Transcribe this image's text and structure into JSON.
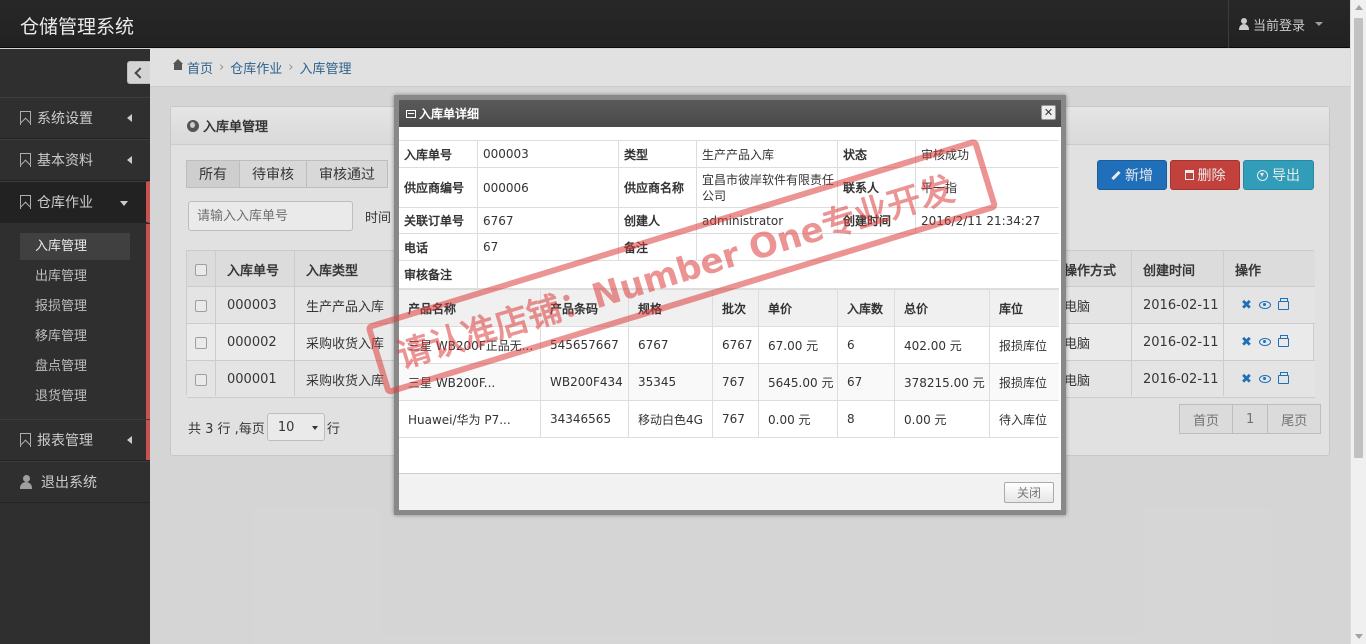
{
  "header": {
    "brand": "仓储管理系统",
    "user_label": "当前登录"
  },
  "sidebar": {
    "groups": [
      {
        "label": "系统设置"
      },
      {
        "label": "基本资料"
      },
      {
        "label": "仓库作业"
      },
      {
        "label": "报表管理"
      },
      {
        "label": "退出系统"
      }
    ],
    "sub_items": [
      "入库管理",
      "出库管理",
      "报损管理",
      "移库管理",
      "盘点管理",
      "退货管理"
    ]
  },
  "breadcrumb": [
    "首页",
    "仓库作业",
    "入库管理"
  ],
  "panel": {
    "title": "入库单管理",
    "tabs": [
      "所有",
      "待审核",
      "审核通过"
    ],
    "buttons": {
      "add": "新增",
      "delete": "删除",
      "export": "导出"
    },
    "search_placeholder": "请输入入库单号",
    "time_label": "时间",
    "columns": {
      "no": "入库单号",
      "type": "入库类型",
      "method": "操作方式",
      "created": "创建时间",
      "actions": "操作"
    },
    "rows": [
      {
        "no": "000003",
        "type": "生产产品入库",
        "method": "电脑",
        "created": "2016-02-11"
      },
      {
        "no": "000002",
        "type": "采购收货入库",
        "method": "电脑",
        "created": "2016-02-11"
      },
      {
        "no": "000001",
        "type": "采购收货入库",
        "method": "电脑",
        "created": "2016-02-11"
      }
    ],
    "footer": {
      "total": "共 3 行 ,每页",
      "page_size": "10",
      "unit": "行"
    },
    "pager": [
      "首页",
      "1",
      "尾页"
    ]
  },
  "modal": {
    "title": "入库单详细",
    "info": {
      "no_label": "入库单号",
      "no": "000003",
      "type_label": "类型",
      "type": "生产产品入库",
      "status_label": "状态",
      "status": "审核成功",
      "supplier_no_label": "供应商编号",
      "supplier_no": "000006",
      "supplier_name_label": "供应商名称",
      "supplier_name": "宜昌市彼岸软件有限责任公司",
      "contact_label": "联系人",
      "contact": "平一指",
      "order_label": "关联订单号",
      "order": "6767",
      "creator_label": "创建人",
      "creator": "administrator",
      "created_label": "创建时间",
      "created": "2016/2/11 21:34:27",
      "phone_label": "电话",
      "phone": "67",
      "remark_label": "备注",
      "remark": "",
      "audit_remark_label": "审核备注",
      "audit_remark": ""
    },
    "detail_columns": [
      "产品名称",
      "产品条码",
      "规格",
      "批次",
      "单价",
      "入库数",
      "总价",
      "库位"
    ],
    "detail_rows": [
      [
        "三星 WB200F正品无...",
        "545657667",
        "6767",
        "6767",
        "67.00 元",
        "6",
        "402.00 元",
        "报损库位"
      ],
      [
        "三星 WB200F...",
        "WB200F434",
        "35345",
        "767",
        "5645.00 元",
        "67",
        "378215.00 元",
        "报损库位"
      ],
      [
        "Huawei/华为 P7...",
        "34346565",
        "移动白色4G",
        "767",
        "0.00 元",
        "8",
        "0.00 元",
        "待入库位"
      ]
    ],
    "close_label": "关闭"
  },
  "watermark": "请认准店铺：Number One专业开发",
  "colors": {
    "accent": "#1a74c9",
    "danger": "#d23f3a",
    "info": "#2ea8c8",
    "sidebar_active_bar": "#d9534f",
    "topbar": "#1b1b1b"
  }
}
